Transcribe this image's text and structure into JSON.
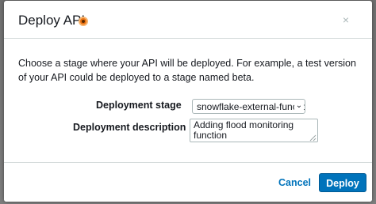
{
  "dialog": {
    "title": "Deploy API",
    "close_glyph": "×",
    "description": "Choose a stage where your API will be deployed. For example, a test version of your API could be deployed to a stage named beta.",
    "stage_label": "Deployment stage",
    "stage_value": "snowflake-external-function",
    "description_label": "Deployment description",
    "description_value": "Adding flood monitoring function",
    "cancel_label": "Cancel",
    "deploy_label": "Deploy"
  },
  "icons": {
    "info": "info-icon",
    "close": "close-icon",
    "dropdown": "chevron-down-icon"
  },
  "colors": {
    "primary": "#0073bb",
    "info_badge": "#ec7211",
    "text": "#16191f"
  }
}
